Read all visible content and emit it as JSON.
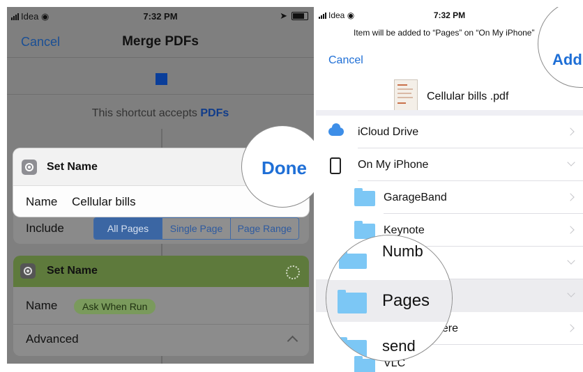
{
  "left": {
    "status": {
      "carrier": "Idea",
      "time": "7:32 PM"
    },
    "nav": {
      "cancel": "Cancel",
      "title": "Merge PDFs"
    },
    "accepts_text": "This shortcut accepts",
    "accepts_type": "PDFs",
    "set_name_card": {
      "title": "Set Name",
      "done": "Done",
      "name_label": "Name",
      "name_value": "Cellular bills"
    },
    "include": {
      "label": "Include",
      "options": [
        "All Pages",
        "Single Page",
        "Page Range"
      ],
      "selected": "All Pages"
    },
    "second_card": {
      "title": "Set Name",
      "name_label": "Name",
      "name_value": "Ask When Run",
      "advanced": "Advanced"
    }
  },
  "right": {
    "status": {
      "carrier": "Idea",
      "time": "7:32 PM"
    },
    "prompt": "Item will be added to “Pages” on “On My iPhone”",
    "cancel": "Cancel",
    "add": "Add",
    "file_name": "Cellular bills .pdf",
    "locations": [
      {
        "label": "iCloud Drive",
        "icon": "cloud-icon"
      },
      {
        "label": "On My iPhone",
        "icon": "phone-icon"
      }
    ],
    "folders": [
      "GarageBand",
      "Keynote",
      "Numbers",
      "Pages",
      "here",
      "send",
      "VLC"
    ],
    "magnifier_labels": {
      "numb": "Numb",
      "pages": "Pages",
      "send": "send"
    }
  }
}
